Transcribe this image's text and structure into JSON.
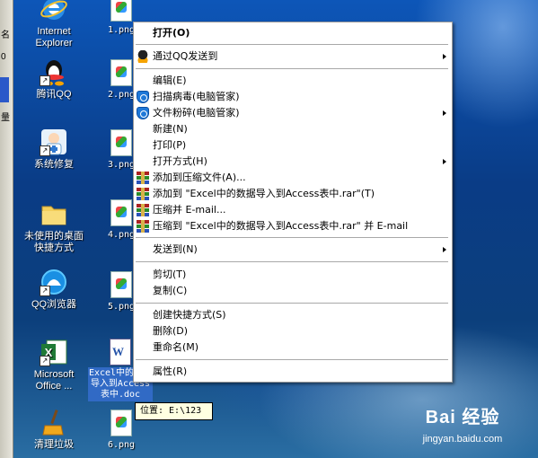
{
  "left_strip": {
    "chars": [
      "名",
      "0",
      "量"
    ]
  },
  "desktop_icons": [
    {
      "id": "ie",
      "label": "Internet Explorer"
    },
    {
      "id": "qq",
      "label": "腾讯QQ"
    },
    {
      "id": "repair",
      "label": "系统修复"
    },
    {
      "id": "folder",
      "label": "未使用的桌面快捷方式"
    },
    {
      "id": "qqbrowser",
      "label": "QQ浏览器"
    },
    {
      "id": "excel",
      "label": "Microsoft Office ..."
    },
    {
      "id": "cleaner",
      "label": "清理垃圾"
    }
  ],
  "files": [
    {
      "label": "1.png"
    },
    {
      "label": "2.png"
    },
    {
      "label": "3.png"
    },
    {
      "label": "4.png"
    },
    {
      "label": "5.png"
    },
    {
      "label": "6.png"
    }
  ],
  "selected_file": {
    "label": "Excel中的数据导入到Access表中.doc"
  },
  "tooltip": {
    "text": "位置: E:\\123"
  },
  "context_menu": {
    "open": "打开(O)",
    "qq_send": "通过QQ发送到",
    "edit": "编辑(E)",
    "scan": "扫描病毒(电脑管家)",
    "shred": "文件粉碎(电脑管家)",
    "new": "新建(N)",
    "print": "打印(P)",
    "open_with": "打开方式(H)",
    "add_archive": "添加到压缩文件(A)...",
    "add_to_rar": "添加到 \"Excel中的数据导入到Access表中.rar\"(T)",
    "compress_email": "压缩并 E-mail...",
    "compress_rar_email": "压缩到 \"Excel中的数据导入到Access表中.rar\" 并 E-mail",
    "send_to": "发送到(N)",
    "cut": "剪切(T)",
    "copy": "复制(C)",
    "create_shortcut": "创建快捷方式(S)",
    "delete": "删除(D)",
    "rename": "重命名(M)",
    "properties": "属性(R)"
  },
  "watermark": {
    "brand": "Bai  经验",
    "site": "jingyan.baidu.com"
  }
}
